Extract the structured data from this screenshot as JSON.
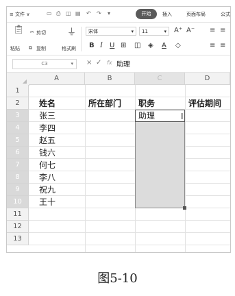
{
  "menubar": {
    "file": "≡ 文件 ∨",
    "tab_active": "开始",
    "tabs": [
      "插入",
      "页面布局",
      "公式"
    ]
  },
  "ribbon": {
    "paste": "粘贴",
    "cut": "剪切",
    "copy": "复制",
    "format_painter": "格式刷",
    "font_name": "宋体",
    "font_size": "11",
    "grow_font": "A⁺",
    "shrink_font": "A⁻"
  },
  "formula_bar": {
    "name_box": "C3",
    "cancel": "×",
    "confirm": "✓",
    "fx": "fx",
    "content": "助理"
  },
  "sheet": {
    "columns": [
      "A",
      "B",
      "C",
      "D"
    ],
    "rows": [
      "1",
      "2",
      "3",
      "4",
      "5",
      "6",
      "7",
      "8",
      "9",
      "10",
      "11",
      "12",
      "13"
    ],
    "headers": {
      "a": "姓名",
      "b": "所在部门",
      "c": "职务",
      "d": "评估期间"
    },
    "names": [
      "张三",
      "李四",
      "赵五",
      "钱六",
      "何七",
      "李八",
      "祝九",
      "王十"
    ],
    "active_value": "助理",
    "cursor": "I"
  },
  "caption": "图5-10"
}
